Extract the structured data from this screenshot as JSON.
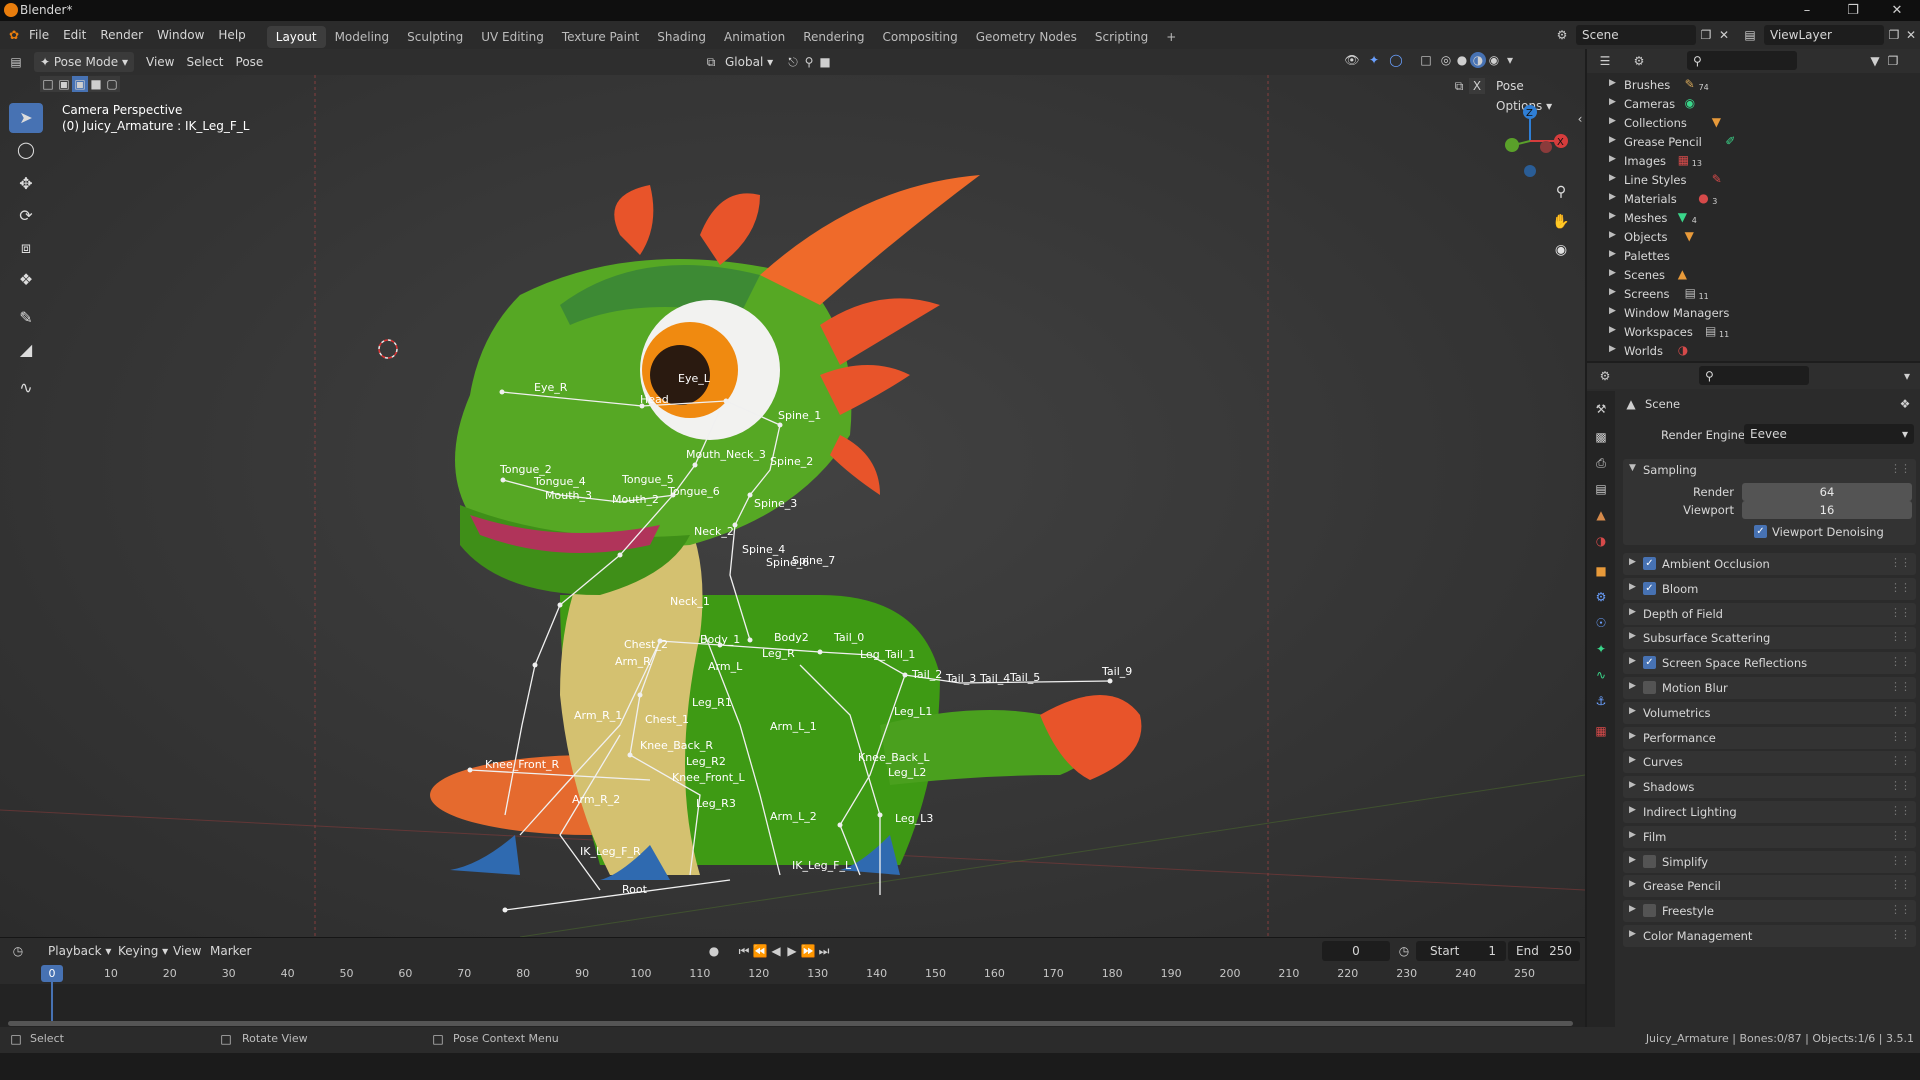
{
  "window": {
    "title": "Blender*"
  },
  "menu": [
    "File",
    "Edit",
    "Render",
    "Window",
    "Help"
  ],
  "workspaces": [
    "Layout",
    "Modeling",
    "Sculpting",
    "UV Editing",
    "Texture Paint",
    "Shading",
    "Animation",
    "Rendering",
    "Compositing",
    "Geometry Nodes",
    "Scripting"
  ],
  "scene_selector": "Scene",
  "viewlayer_selector": "ViewLayer",
  "viewport_header": {
    "mode": "Pose Mode",
    "menus": [
      "View",
      "Select",
      "Pose"
    ],
    "orientation": "Global",
    "pose_options": "Pose Options"
  },
  "viewport": {
    "camera_label": "Camera Perspective",
    "active_object": "(0) Juicy_Armature : IK_Leg_F_L",
    "bones": [
      "Eye_R",
      "Eye_L",
      "Head",
      "Spine_1",
      "Mouth_Neck_3",
      "Spine_2",
      "Tongue_2",
      "Tongue_4",
      "Tongue_5",
      "Mouth_3",
      "Mouth_2",
      "Tongue_6",
      "Spine_3",
      "Neck_2",
      "Spine_4",
      "Spine_6",
      "Spine_7",
      "Neck_1",
      "Chest_2",
      "Body_1",
      "Body2",
      "Tail_0",
      "Arm_R",
      "Leg_R",
      "Leg_Tail_1",
      "Arm_L",
      "Tail_2",
      "Tail_3",
      "Tail_4",
      "Tail_5",
      "Tail_9",
      "Leg_R1",
      "Leg_L1",
      "Arm_R_1",
      "Chest_1",
      "Arm_L_1",
      "Knee_Back_R",
      "Knee_Front_R",
      "Leg_R2",
      "Knee_Back_L",
      "Knee_Front_L",
      "Leg_L2",
      "Arm_R_2",
      "Leg_R3",
      "Arm_L_2",
      "Leg_L3",
      "IK_Leg_F_R",
      "IK_Leg_F_L",
      "Root"
    ]
  },
  "timeline": {
    "menus": [
      "Playback",
      "Keying",
      "View",
      "Marker"
    ],
    "current_frame": "0",
    "start_label": "Start",
    "start": "1",
    "end_label": "End",
    "end": "250",
    "ticks": [
      "0",
      "10",
      "20",
      "30",
      "40",
      "50",
      "60",
      "70",
      "80",
      "90",
      "100",
      "110",
      "120",
      "130",
      "140",
      "150",
      "160",
      "170",
      "180",
      "190",
      "200",
      "210",
      "220",
      "230",
      "240",
      "250"
    ]
  },
  "statusbar": {
    "select": "Select",
    "rotate_view": "Rotate View",
    "pose_context_menu": "Pose Context Menu",
    "info": "Juicy_Armature | Bones:0/87 | Objects:1/6 | 3.5.1"
  },
  "outliner": {
    "items": [
      {
        "name": "Brushes",
        "count": "74"
      },
      {
        "name": "Cameras",
        "count": ""
      },
      {
        "name": "Collections",
        "count": ""
      },
      {
        "name": "Grease Pencil",
        "count": ""
      },
      {
        "name": "Images",
        "count": "13"
      },
      {
        "name": "Line Styles",
        "count": ""
      },
      {
        "name": "Materials",
        "count": "3"
      },
      {
        "name": "Meshes",
        "count": "4"
      },
      {
        "name": "Objects",
        "count": ""
      },
      {
        "name": "Palettes",
        "count": ""
      },
      {
        "name": "Scenes",
        "count": ""
      },
      {
        "name": "Screens",
        "count": "11"
      },
      {
        "name": "Window Managers",
        "count": ""
      },
      {
        "name": "Workspaces",
        "count": "11"
      },
      {
        "name": "Worlds",
        "count": ""
      }
    ]
  },
  "properties": {
    "context": "Scene",
    "render_engine_label": "Render Engine",
    "render_engine": "Eevee",
    "sampling": {
      "title": "Sampling",
      "render_label": "Render",
      "render": "64",
      "viewport_label": "Viewport",
      "viewport": "16",
      "denoise_label": "Viewport Denoising"
    },
    "panels": [
      {
        "label": "Ambient Occlusion",
        "checkbox": "on"
      },
      {
        "label": "Bloom",
        "checkbox": "on"
      },
      {
        "label": "Depth of Field",
        "checkbox": "none"
      },
      {
        "label": "Subsurface Scattering",
        "checkbox": "none"
      },
      {
        "label": "Screen Space Reflections",
        "checkbox": "on"
      },
      {
        "label": "Motion Blur",
        "checkbox": "off"
      },
      {
        "label": "Volumetrics",
        "checkbox": "none"
      },
      {
        "label": "Performance",
        "checkbox": "none"
      },
      {
        "label": "Curves",
        "checkbox": "none"
      },
      {
        "label": "Shadows",
        "checkbox": "none"
      },
      {
        "label": "Indirect Lighting",
        "checkbox": "none"
      },
      {
        "label": "Film",
        "checkbox": "none"
      },
      {
        "label": "Simplify",
        "checkbox": "off"
      },
      {
        "label": "Grease Pencil",
        "checkbox": "none"
      },
      {
        "label": "Freestyle",
        "checkbox": "off"
      },
      {
        "label": "Color Management",
        "checkbox": "none"
      }
    ]
  },
  "colors": {
    "accent": "#4772b3",
    "playhead": "#4772b3",
    "blender_orange": "#e87d0d"
  }
}
